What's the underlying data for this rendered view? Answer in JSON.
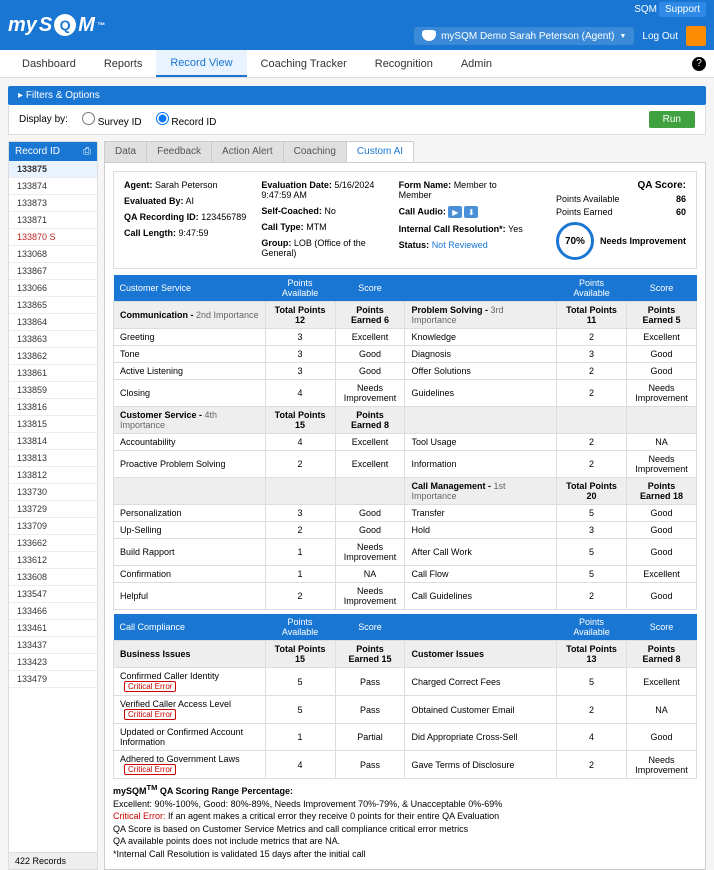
{
  "brand": {
    "pre": "my",
    "s": "S",
    "q": "Q",
    "m": "M",
    "tm": "™"
  },
  "topLinks": {
    "sqm": "SQM",
    "support": "Support"
  },
  "user": {
    "label": "mySQM Demo Sarah Peterson (Agent)",
    "logout": "Log Out"
  },
  "nav": {
    "dashboard": "Dashboard",
    "reports": "Reports",
    "record": "Record View",
    "coaching": "Coaching Tracker",
    "recognition": "Recognition",
    "admin": "Admin"
  },
  "filters": "Filters & Options",
  "display": {
    "label": "Display by:",
    "survey": "Survey ID",
    "record": "Record ID",
    "run": "Run"
  },
  "records": {
    "head": "Record ID",
    "count": "422 Records",
    "items": [
      "133875",
      "133874",
      "133873",
      "133871",
      "133870 S",
      "133068",
      "133867",
      "133066",
      "133865",
      "133864",
      "133863",
      "133862",
      "133861",
      "133859",
      "133816",
      "133815",
      "133814",
      "133813",
      "133812",
      "133730",
      "133729",
      "133709",
      "133662",
      "133612",
      "133608",
      "133547",
      "133466",
      "133461",
      "133437",
      "133423",
      "133479"
    ]
  },
  "tabs": {
    "data": "Data",
    "feedback": "Feedback",
    "action": "Action Alert",
    "coaching": "Coaching",
    "custom": "Custom AI"
  },
  "summary": {
    "agent_l": "Agent:",
    "agent_v": "Sarah Peterson",
    "evalby_l": "Evaluated By:",
    "evalby_v": "AI",
    "rec_l": "QA Recording ID:",
    "rec_v": "123456789",
    "len_l": "Call Length:",
    "len_v": "9:47:59",
    "date_l": "Evaluation Date:",
    "date_v": "5/16/2024 9:47:59 AM",
    "self_l": "Self-Coached:",
    "self_v": "No",
    "type_l": "Call Type:",
    "type_v": "MTM",
    "group_l": "Group:",
    "group_v": "LOB (Office of the General)",
    "form_l": "Form Name:",
    "form_v": "Member to Member",
    "audio_l": "Call Audio:",
    "icr_l": "Internal Call Resolution*:",
    "icr_v": "Yes",
    "status_l": "Status:",
    "status_v": "Not Reviewed"
  },
  "qa": {
    "title": "QA Score:",
    "pa_l": "Points Available",
    "pa_v": "86",
    "pe_l": "Points Earned",
    "pe_v": "60",
    "pct": "70%",
    "rating": "Needs Improvement"
  },
  "hdr": {
    "pa": "Points Available",
    "score": "Score"
  },
  "cs": {
    "title": "Customer Service",
    "g1": {
      "name": "Communication",
      "imp": "2nd Importance",
      "pa": "Total Points 12",
      "sc": "Points Earned 6"
    },
    "g1r": [
      {
        "n": "Greeting",
        "p": "3",
        "s": "Excellent"
      },
      {
        "n": "Tone",
        "p": "3",
        "s": "Good"
      },
      {
        "n": "Active Listening",
        "p": "3",
        "s": "Good"
      },
      {
        "n": "Closing",
        "p": "4",
        "s": "Needs Improvement"
      }
    ],
    "g2": {
      "name": "Customer Service",
      "imp": "4th Importance",
      "pa": "Total Points 15",
      "sc": "Points Earned 8"
    },
    "g2r": [
      {
        "n": "Accountability",
        "p": "4",
        "s": "Excellent"
      },
      {
        "n": "Proactive Problem Solving",
        "p": "2",
        "s": "Excellent"
      },
      {
        "n": "Personalization",
        "p": "3",
        "s": "Good"
      },
      {
        "n": "Up-Selling",
        "p": "2",
        "s": "Good"
      },
      {
        "n": "Build Rapport",
        "p": "1",
        "s": "Needs Improvement"
      },
      {
        "n": "Confirmation",
        "p": "1",
        "s": "NA"
      },
      {
        "n": "Helpful",
        "p": "2",
        "s": "Needs Improvement"
      }
    ],
    "g3": {
      "name": "Problem Solving",
      "imp": "3rd Importance",
      "pa": "Total Points 11",
      "sc": "Points Earned 5"
    },
    "g3r": [
      {
        "n": "Knowledge",
        "p": "2",
        "s": "Excellent"
      },
      {
        "n": "Diagnosis",
        "p": "3",
        "s": "Good"
      },
      {
        "n": "Offer Solutions",
        "p": "2",
        "s": "Good"
      },
      {
        "n": "Guidelines",
        "p": "2",
        "s": "Needs Improvement"
      },
      {
        "n": "Tool Usage",
        "p": "2",
        "s": "NA"
      },
      {
        "n": "Information",
        "p": "2",
        "s": "Needs Improvement"
      }
    ],
    "g4": {
      "name": "Call Management",
      "imp": "1st Importance",
      "pa": "Total Points 20",
      "sc": "Points Earned 18"
    },
    "g4r": [
      {
        "n": "Transfer",
        "p": "5",
        "s": "Good"
      },
      {
        "n": "Hold",
        "p": "3",
        "s": "Good"
      },
      {
        "n": "After Call Work",
        "p": "5",
        "s": "Good"
      },
      {
        "n": "Call Flow",
        "p": "5",
        "s": "Excellent"
      },
      {
        "n": "Call Guidelines",
        "p": "2",
        "s": "Good"
      }
    ]
  },
  "cc": {
    "title": "Call Compliance",
    "crit": "Critical Error",
    "g1": {
      "name": "Business Issues",
      "pa": "Total Points 15",
      "sc": "Points Earned 15"
    },
    "g1r": [
      {
        "n": "Confirmed Caller Identity",
        "p": "5",
        "s": "Pass",
        "crit": true
      },
      {
        "n": "Verified Caller Access Level",
        "p": "5",
        "s": "Pass",
        "crit": true
      },
      {
        "n": "Updated or Confirmed Account Information",
        "p": "1",
        "s": "Partial"
      },
      {
        "n": "Adhered to Government Laws",
        "p": "4",
        "s": "Pass",
        "crit": true
      }
    ],
    "g2": {
      "name": "Customer Issues",
      "pa": "Total Points 13",
      "sc": "Points Earned 8"
    },
    "g2r": [
      {
        "n": "Charged Correct Fees",
        "p": "5",
        "s": "Excellent"
      },
      {
        "n": "Obtained Customer Email",
        "p": "2",
        "s": "NA"
      },
      {
        "n": "Did Appropriate Cross-Sell",
        "p": "4",
        "s": "Good"
      },
      {
        "n": "Gave Terms of Disclosure",
        "p": "2",
        "s": "Needs Improvement"
      }
    ]
  },
  "notes": {
    "l1a": "mySQM",
    "l1tm": "TM",
    "l1b": " QA Scoring Range Percentage:",
    "l2": "Excellent: 90%-100%, Good: 80%-89%, Needs Improvement 70%-79%, & Unacceptable 0%-69%",
    "l3a": "Critical Error:",
    "l3b": " If an agent makes a critical error they receive 0 points for their entire QA Evaluation",
    "l4": "QA Score is based on Customer Service Metrics and call compliance critical error metrics",
    "l5": "QA available points does not include metrics that are NA.",
    "l6": "*Internal Call Resolution is validated 15 days after the initial call"
  }
}
